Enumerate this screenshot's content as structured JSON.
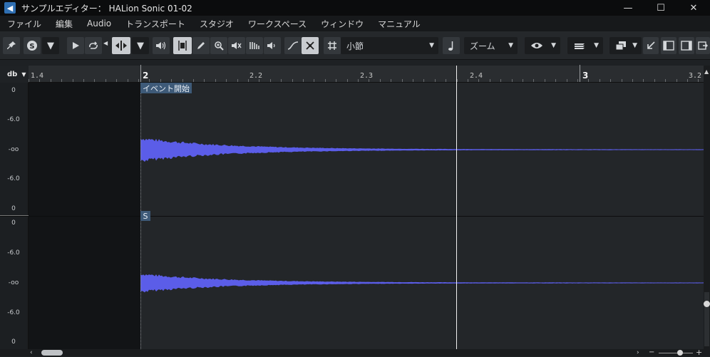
{
  "window": {
    "title": "サンプルエディター： HALion Sonic 01-02",
    "app_icon_glyph": "◀",
    "minimize": "—",
    "maximize": "☐",
    "close": "✕"
  },
  "menu": [
    "ファイル",
    "編集",
    "Audio",
    "トランスポート",
    "スタジオ",
    "ワークスペース",
    "ウィンドウ",
    "マニュアル"
  ],
  "toolbar": {
    "snap_value": "小節",
    "zoom_label": "ズーム",
    "colors": {
      "active_tool": "#c9ccd0",
      "waveform": "#5b5de8"
    }
  },
  "ruler": {
    "unit": "db",
    "labels": [
      {
        "text": "1.4",
        "major": false
      },
      {
        "text": "2",
        "major": true
      },
      {
        "text": "2.2",
        "major": false
      },
      {
        "text": "2.3",
        "major": false
      },
      {
        "text": "2.4",
        "major": false
      },
      {
        "text": "3",
        "major": true
      },
      {
        "text": "3.2",
        "major": false
      }
    ]
  },
  "axis": {
    "channel1": [
      "0",
      "-6.0",
      "-oo",
      "-6.0",
      "0"
    ],
    "channel2": [
      "0",
      "-6.0",
      "-oo",
      "-6.0",
      "0"
    ]
  },
  "markers": {
    "event_start": "イベント開始",
    "sustain": "S"
  },
  "icons": [
    "pin-icon",
    "solo-icon",
    "play-icon",
    "loop-icon",
    "snap-icon",
    "speaker-icon",
    "range-tool-icon",
    "pencil-icon",
    "zoom-icon",
    "mute-icon",
    "time-warp-icon",
    "audition-icon",
    "curve-icon",
    "hitpoint-icon",
    "grid-icon",
    "note-icon",
    "eye-icon",
    "layers-icon",
    "window-layout-icon",
    "left-zone-icon",
    "inspector-icon",
    "right-zone-icon"
  ]
}
